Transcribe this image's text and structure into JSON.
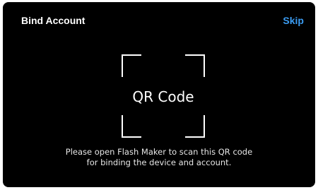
{
  "header": {
    "title": "Bind Account",
    "skip_label": "Skip"
  },
  "qr": {
    "placeholder_label": "QR Code"
  },
  "instructions": {
    "line1": "Please open Flash Maker to scan this QR code",
    "line2": "for binding the device and account."
  },
  "colors": {
    "background": "#000000",
    "text": "#ffffff",
    "accent": "#3b9cf2"
  }
}
